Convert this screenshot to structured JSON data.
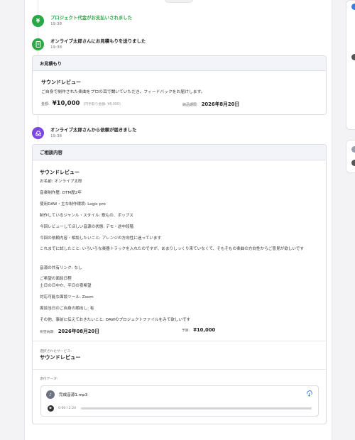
{
  "events": [
    {
      "title": "プロジェクト代金がお支払いされました",
      "time": "19:38",
      "icon": "yen-icon",
      "color": "#2aa845"
    },
    {
      "title": "オンライブ太郎さんにお見積もりを送りました",
      "time": "19:38",
      "icon": "document-icon",
      "color": "#2aa845"
    },
    {
      "title": "オンライブ太郎さんから依頼が届きました",
      "time": "19:38",
      "icon": "inbox-icon",
      "color": "#7b46e0"
    }
  ],
  "quote": {
    "header": "お見積もり",
    "title": "サウンドレビュー",
    "description": "ご自身で制作された楽曲をプロの耳で聞いていただき、フィードバックをお届けします。",
    "price_label": "金額:",
    "price": "¥10,000",
    "price_note": "(円手取り金額: ¥8,000)",
    "delivery_label": "納品期限:",
    "delivery_date": "2026年8月20日"
  },
  "request": {
    "header": "ご相談内容",
    "title": "サウンドレビュー",
    "lines": [
      "お名前: オンライブ太郎",
      "音楽制作歴: DTM歴2年",
      "使用DAW・主な制作環境: Logic pro",
      "制作しているジャンル・スタイル: 歌もの、ポップス",
      "今回レビューしてほしい音源の状態: デモ・途中段階",
      "今回の依頼内容・相談したいこと: アレンジの方向性に迷っています",
      "これまでに試したこと: いろいろな楽器トラックを入れたのですが、あまりしっくり来ていなくて、そもそもの楽曲の方向性からご意見が欲しいです",
      "音源の共有リンク: なし",
      "ご希望の面談日程",
      "土日の日中か、平日の夜希望",
      "対応可能な面談ツール: Zoom",
      "面談当日のご自身の顔出し: 有",
      "その他、事前に伝えておきたいこと: DAWのプロジェクトファイルをみて欲しいです"
    ],
    "deadline_label": "希望納期:",
    "deadline": "2026年08月20日",
    "budget_label": "予算:",
    "budget": "¥10,000",
    "service_label": "選択されたサービス:",
    "service_name": "サウンドレビュー",
    "attachment_label": "添付データ:"
  },
  "audio": {
    "file_name": "完成音源1.mp3",
    "time": "0:00 / 2:24",
    "progress": 0.0,
    "icons": [
      "music-file-icon",
      "download-icon",
      "play-icon"
    ]
  },
  "colors": {
    "accent_green": "#2aa845",
    "accent_purple": "#7b46e0",
    "link_blue": "#3c7de0"
  }
}
